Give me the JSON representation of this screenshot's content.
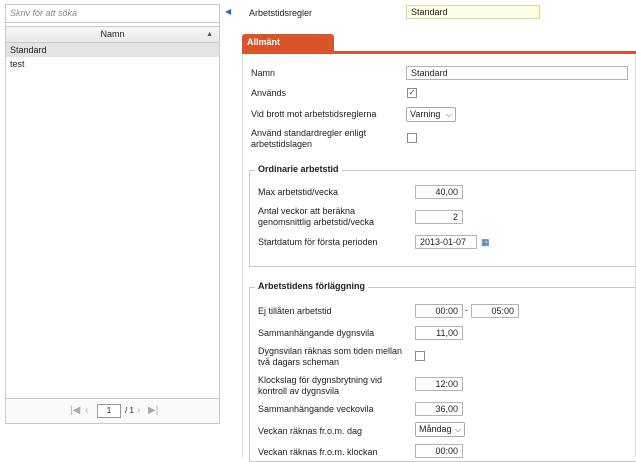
{
  "left": {
    "search_placeholder": "Skriv för att söka",
    "column_header": "Namn",
    "items": [
      "Standard",
      "test"
    ],
    "pager": {
      "page": "1",
      "total": "/ 1"
    }
  },
  "top": {
    "label": "Arbetstidsregler",
    "value": "Standard"
  },
  "tab": {
    "label": "Allmänt"
  },
  "general": {
    "name_label": "Namn",
    "name_value": "Standard",
    "used_label": "Används",
    "used_checked": true,
    "violation_label": "Vid brott mot arbetstidsreglerna",
    "violation_value": "Varning",
    "standard_rules_label": "Använd standardregler enligt arbetstidslagen"
  },
  "ordinary": {
    "legend": "Ordinarie arbetstid",
    "max_label": "Max arbetstid/vecka",
    "max_value": "40,00",
    "weeks_label": "Antal veckor att beräkna genomsnittlig arbetstid/vecka",
    "weeks_value": "2",
    "start_label": "Startdatum för första perioden",
    "start_value": "2013-01-07"
  },
  "placement": {
    "legend": "Arbetstidens förläggning",
    "forbidden_label": "Ej tillåten arbetstid",
    "forbidden_from": "00:00",
    "forbidden_to": "05:00",
    "daily_rest_label": "Sammanhängande dygnsvila",
    "daily_rest_value": "11,00",
    "rest_between_label": "Dygnsvilan räknas som tiden mellan två dagars scheman",
    "day_break_label": "Klockslag för dygnsbrytning vid kontroll av dygnsvila",
    "day_break_value": "12:00",
    "weekly_rest_label": "Sammanhängande veckovila",
    "weekly_rest_value": "36,00",
    "week_from_day_label": "Veckan räknas fr.o.m. dag",
    "week_from_day_value": "Måndag",
    "week_from_time_label": "Veckan räknas fr.o.m. klockan",
    "week_from_time_value": "00:00"
  }
}
